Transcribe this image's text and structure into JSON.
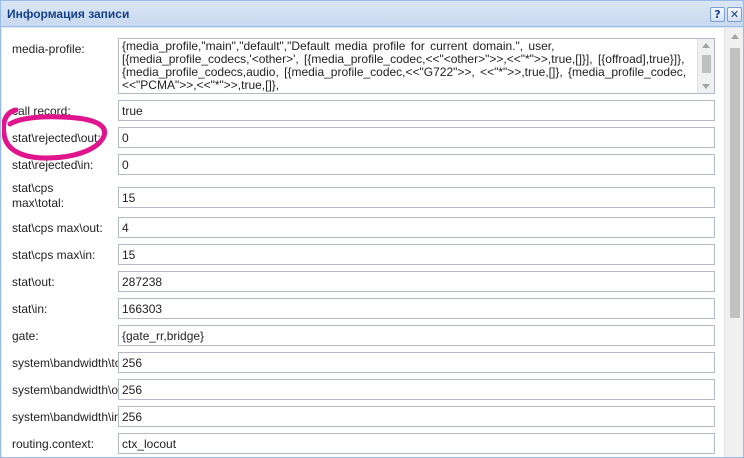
{
  "window": {
    "title": "Информация записи",
    "help_label": "?",
    "close_label": "✕"
  },
  "media_profile": {
    "label": "media-profile:",
    "value": "{media_profile,\"main\",\"default\",\"Default media profile for current domain.\", user, [{media_profile_codecs,'<other>', [{media_profile_codec,<<\"<other>\">>,<<\"*\">>,true,[]}], [{offroad],true}]}, {media_profile_codecs,audio, [{media_profile_codec,<<\"G722\">>, <<\"*\">>,true,[]}, {media_profile_codec,<<\"PCMA\">>,<<\"*\">>,true,[]},"
  },
  "fields": [
    {
      "label": "call record:",
      "value": "true"
    },
    {
      "label": "stat\\rejected\\out:",
      "value": "0"
    },
    {
      "label": "stat\\rejected\\in:",
      "value": "0"
    },
    {
      "label": "stat\\cps max\\total:",
      "value": "15"
    },
    {
      "label": "stat\\cps max\\out:",
      "value": "4"
    },
    {
      "label": "stat\\cps max\\in:",
      "value": "15"
    },
    {
      "label": "stat\\out:",
      "value": "287238"
    },
    {
      "label": "stat\\in:",
      "value": "166303"
    },
    {
      "label": "gate:",
      "value": "{gate_rr,bridge}"
    },
    {
      "label": "system\\bandwidth\\total:",
      "value": "256"
    },
    {
      "label": "system\\bandwidth\\out:",
      "value": "256"
    },
    {
      "label": "system\\bandwidth\\in:",
      "value": "256"
    },
    {
      "label": "routing.context:",
      "value": "ctx_locout"
    }
  ],
  "annotation_color": "#e0148c"
}
